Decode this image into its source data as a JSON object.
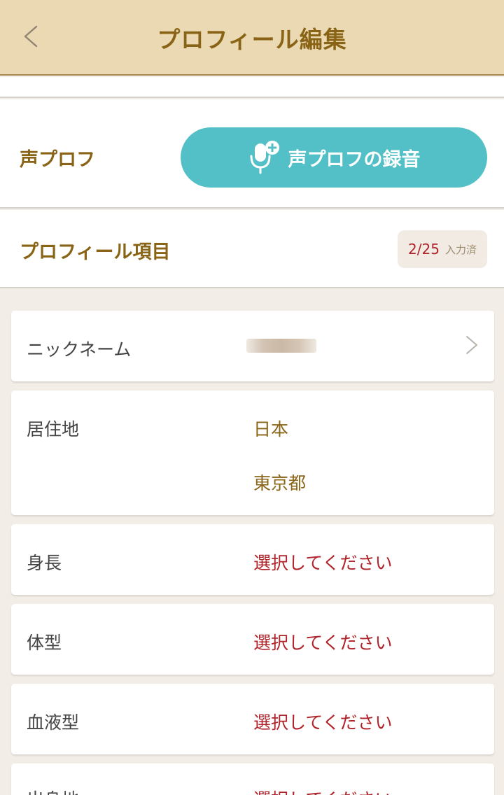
{
  "header": {
    "title": "プロフィール編集"
  },
  "voice": {
    "label": "声プロフ",
    "button_label": "声プロフの録音"
  },
  "profile_items": {
    "label": "プロフィール項目",
    "count": "2/25",
    "count_suffix": "入力済"
  },
  "fields": {
    "nickname": {
      "label": "ニックネーム"
    },
    "residence": {
      "label": "居住地",
      "country": "日本",
      "prefecture": "東京都"
    },
    "height": {
      "label": "身長",
      "value": "選択してください"
    },
    "body_type": {
      "label": "体型",
      "value": "選択してください"
    },
    "blood_type": {
      "label": "血液型",
      "value": "選択してください"
    },
    "birthplace": {
      "label": "出身地",
      "value": "選択してください"
    }
  },
  "colors": {
    "header_bg": "#ead9b3",
    "accent_gold": "#8a6416",
    "button_teal": "#52c0c6",
    "prompt_red": "#b0232a",
    "page_bg": "#f2ede6"
  }
}
